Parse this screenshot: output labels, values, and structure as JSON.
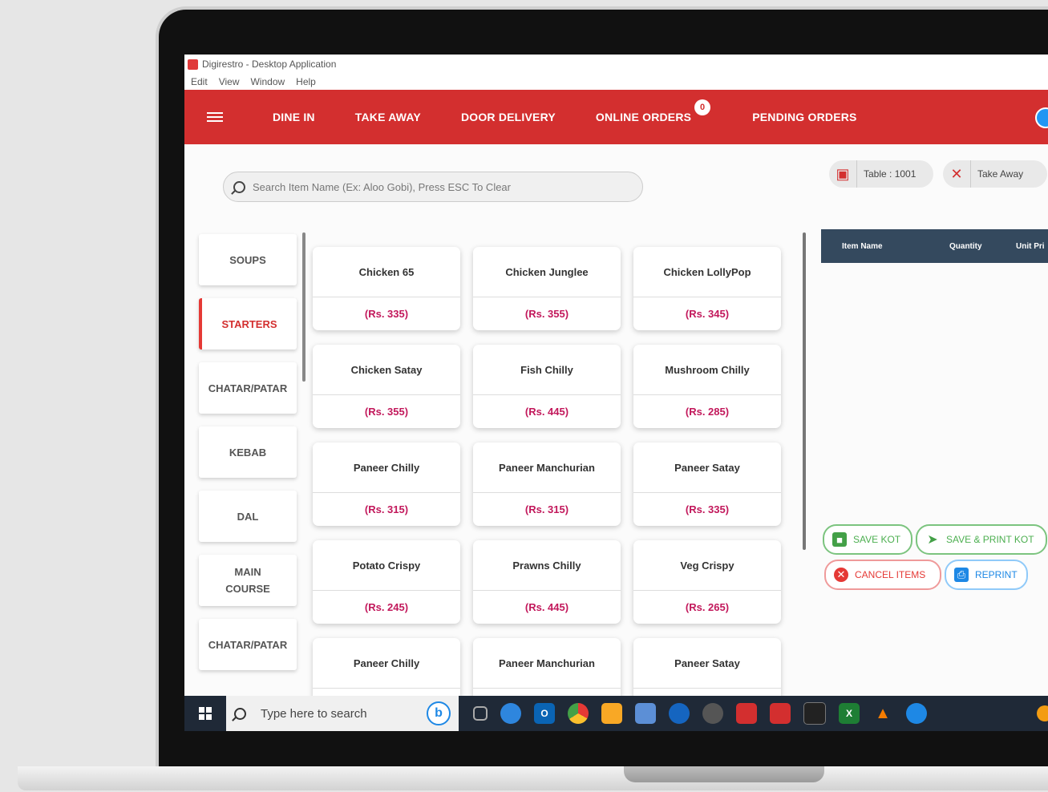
{
  "window": {
    "title": "Digirestro - Desktop Application"
  },
  "menu": [
    "Edit",
    "View",
    "Window",
    "Help"
  ],
  "nav": {
    "dine_in": "DINE IN",
    "take_away": "TAKE AWAY",
    "door_delivery": "DOOR DELIVERY",
    "online_orders": "ONLINE ORDERS",
    "online_orders_count": "0",
    "pending_orders": "PENDING ORDERS"
  },
  "search": {
    "placeholder": "Search Item Name (Ex: Aloo Gobi), Press ESC To Clear"
  },
  "chips": {
    "table": "Table : 1001",
    "take_away": "Take Away"
  },
  "categories": [
    {
      "label": "SOUPS"
    },
    {
      "label": "STARTERS"
    },
    {
      "label": "CHATAR/PATAR"
    },
    {
      "label": "KEBAB"
    },
    {
      "label": "DAL"
    },
    {
      "label": "MAIN COURSE"
    },
    {
      "label": "CHATAR/PATAR"
    }
  ],
  "items": [
    {
      "name": "Chicken 65",
      "price": "(Rs. 335)"
    },
    {
      "name": "Chicken Junglee",
      "price": "(Rs. 355)"
    },
    {
      "name": "Chicken LollyPop",
      "price": "(Rs. 345)"
    },
    {
      "name": "Chicken Satay",
      "price": "(Rs. 355)"
    },
    {
      "name": "Fish Chilly",
      "price": "(Rs. 445)"
    },
    {
      "name": "Mushroom Chilly",
      "price": "(Rs. 285)"
    },
    {
      "name": "Paneer Chilly",
      "price": "(Rs. 315)"
    },
    {
      "name": "Paneer Manchurian",
      "price": "(Rs. 315)"
    },
    {
      "name": "Paneer Satay",
      "price": "(Rs. 335)"
    },
    {
      "name": "Potato Crispy",
      "price": "(Rs. 245)"
    },
    {
      "name": "Prawns Chilly",
      "price": "(Rs. 445)"
    },
    {
      "name": "Veg Crispy",
      "price": "(Rs. 265)"
    },
    {
      "name": "Paneer Chilly",
      "price": ""
    },
    {
      "name": "Paneer Manchurian",
      "price": ""
    },
    {
      "name": "Paneer Satay",
      "price": ""
    }
  ],
  "order_table": {
    "col_item": "Item Name",
    "col_qty": "Quantity",
    "col_price": "Unit Pri"
  },
  "actions": {
    "save_kot": "SAVE KOT",
    "save_print_kot": "SAVE & PRINT KOT",
    "cancel_items": "CANCEL ITEMS",
    "reprint": "REPRINT"
  },
  "taskbar": {
    "search_placeholder": "Type here to search"
  },
  "colors": {
    "brand_red": "#d32f2f",
    "price_pink": "#c2185b",
    "header_navy": "#34495e"
  }
}
